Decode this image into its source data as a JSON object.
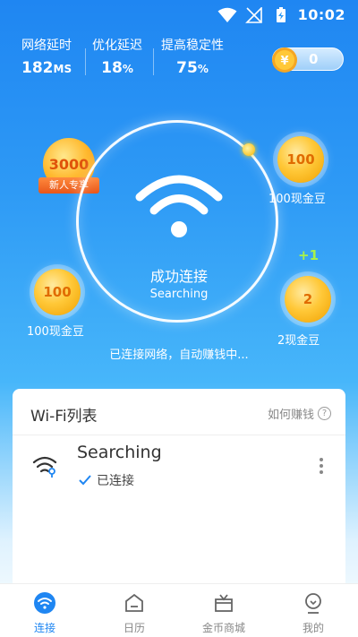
{
  "status_bar": {
    "time": "10:02"
  },
  "stats": [
    {
      "label": "网络延时",
      "value": "182",
      "unit": "MS"
    },
    {
      "label": "优化延迟",
      "value": "18",
      "unit": "%"
    },
    {
      "label": "提高稳定性",
      "value": "75",
      "unit": "%"
    }
  ],
  "coins_balance": {
    "symbol": "¥",
    "count": "0"
  },
  "newbie": {
    "amount": "3000",
    "ribbon": "新人专享"
  },
  "coins": [
    {
      "value": "100",
      "label": "100现金豆"
    },
    {
      "value": "100",
      "label": "100现金豆"
    },
    {
      "value": "2",
      "label": "2现金豆"
    }
  ],
  "plus_one": "+1",
  "connection": {
    "title": "成功连接",
    "ssid": "Searching",
    "status_text": "已连接网络，自动赚钱中..."
  },
  "wifi_list": {
    "title": "Wi-Fi列表",
    "help_label": "如何赚钱",
    "help_icon_text": "?",
    "items": [
      {
        "ssid": "Searching",
        "status": "已连接"
      }
    ]
  },
  "bottom_nav": [
    {
      "label": "连接",
      "icon": "wifi-icon",
      "active": true
    },
    {
      "label": "日历",
      "icon": "calendar-icon",
      "active": false
    },
    {
      "label": "金币商城",
      "icon": "gift-icon",
      "active": false
    },
    {
      "label": "我的",
      "icon": "profile-icon",
      "active": false
    }
  ],
  "colors": {
    "accent": "#1f86f2",
    "coin": "#ffc838",
    "plus": "#a8f24a"
  }
}
